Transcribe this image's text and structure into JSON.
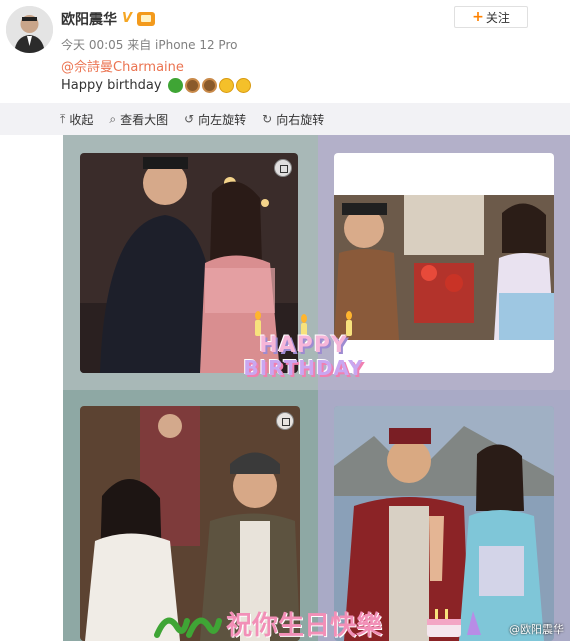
{
  "post": {
    "username": "欧阳震华",
    "follow_label": "关注",
    "meta": "今天 00:05 来自 iPhone 12 Pro",
    "mention": "@佘詩曼Charmaine",
    "text": "Happy birthday",
    "emojis": [
      "snake-emoji",
      "cake-emoji",
      "cake-emoji",
      "face-emoji",
      "face-emoji"
    ]
  },
  "toolbar": {
    "collapse": "收起",
    "view_large": "查看大图",
    "rotate_left": "向左旋转",
    "rotate_right": "向右旋转"
  },
  "image": {
    "banner_line1": "HAPPY",
    "banner_line2": "BIRTHDAY",
    "caption": "祝你生日快樂",
    "watermark": "@欧阳震华"
  },
  "colors": {
    "accent": "#ff8200",
    "link": "#eb7350",
    "toolbar_bg": "#f2f2f5"
  }
}
